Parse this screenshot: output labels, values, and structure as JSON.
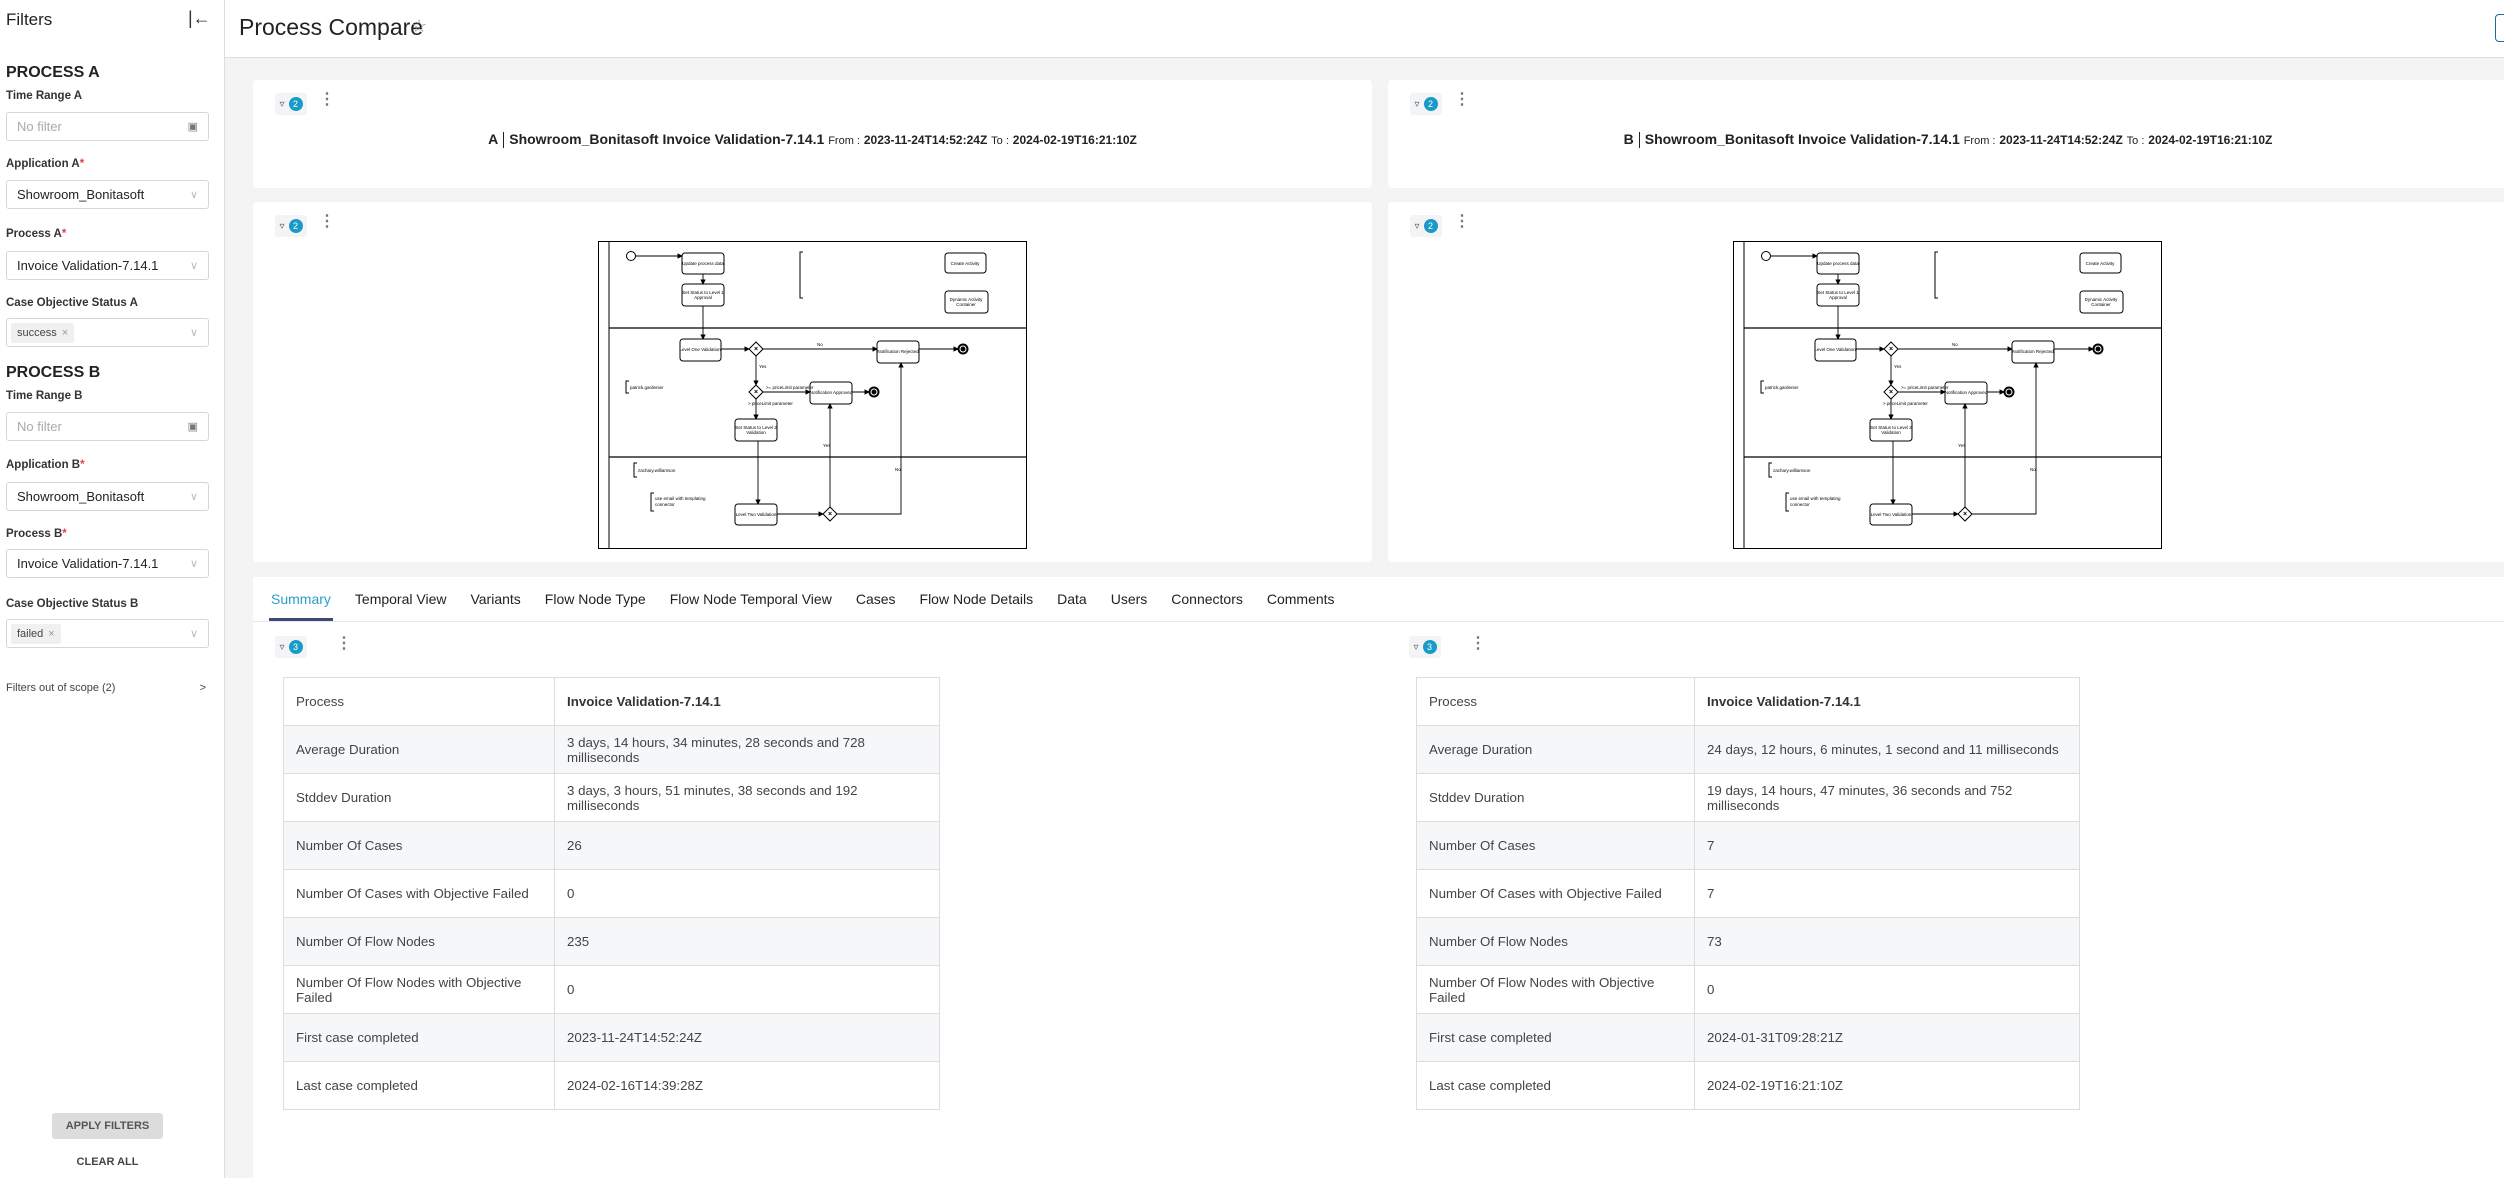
{
  "sidebar": {
    "title": "Filters",
    "collapse_icon": "collapse-left-icon",
    "process_a": {
      "heading": "PROCESS A",
      "time_range_label": "Time Range A",
      "time_range_placeholder": "No filter",
      "application_label": "Application A",
      "application_value": "Showroom_Bonitasoft",
      "process_label": "Process A",
      "process_value": "Invoice Validation-7.14.1",
      "status_label": "Case Objective Status A",
      "status_tag": "success"
    },
    "process_b": {
      "heading": "PROCESS B",
      "time_range_label": "Time Range B",
      "time_range_placeholder": "No filter",
      "application_label": "Application B",
      "application_value": "Showroom_Bonitasoft",
      "process_label": "Process B",
      "process_value": "Invoice Validation-7.14.1",
      "status_label": "Case Objective Status B",
      "status_tag": "failed"
    },
    "required_mark": "*",
    "out_of_scope": "Filters out of scope (2)",
    "apply": "APPLY FILTERS",
    "clear": "CLEAR ALL"
  },
  "header": {
    "title": "Process Compare"
  },
  "colors": {
    "accent": "#1a9bc7",
    "tab_underline": "#3c4a7a"
  },
  "cards": {
    "a": {
      "filter_count": "2",
      "letter": "A",
      "name": "Showroom_Bonitasoft Invoice Validation-7.14.1",
      "from_label": "From :",
      "from": "2023-11-24T14:52:24Z",
      "to_label": "To :",
      "to": "2024-02-19T16:21:10Z",
      "diagram_filter_count": "2"
    },
    "b": {
      "filter_count": "2",
      "letter": "B",
      "name": "Showroom_Bonitasoft Invoice Validation-7.14.1",
      "from_label": "From :",
      "from": "2023-11-24T14:52:24Z",
      "to_label": "To :",
      "to": "2024-02-19T16:21:10Z",
      "diagram_filter_count": "2"
    }
  },
  "diagram": {
    "tasks": {
      "update": "Update process data",
      "status1": "Set Status to Level 1",
      "status1b": "Approval",
      "create": "Create Activity",
      "dynamic": "Dynamic Activity",
      "dynamicb": "Container",
      "lvl1": "Level One Validation",
      "rejected": "Notification Rejected",
      "approved": "Notification Approved",
      "status2": "Set Status to Level 2",
      "status2b": "Validation",
      "lvl2": "Level Two Validation"
    },
    "labels": {
      "no": "No",
      "yes": "Yes",
      "ge": ">= priceLimit parameter",
      "gt": "> priceLimit parameter",
      "patrick": "patrick.gardenier",
      "zachary": "zachary.williamson",
      "email": "use email with templating",
      "email2": "connector"
    }
  },
  "tabs": [
    "Summary",
    "Temporal View",
    "Variants",
    "Flow Node Type",
    "Flow Node Temporal View",
    "Cases",
    "Flow Node Details",
    "Data",
    "Users",
    "Connectors",
    "Comments"
  ],
  "summary": {
    "a": {
      "filter_count": "3",
      "rows": [
        [
          "Process",
          "Invoice Validation-7.14.1"
        ],
        [
          "Average Duration",
          "3 days, 14 hours, 34 minutes, 28 seconds and 728 milliseconds"
        ],
        [
          "Stddev Duration",
          "3 days, 3 hours, 51 minutes, 38 seconds and 192 milliseconds"
        ],
        [
          "Number Of Cases",
          "26"
        ],
        [
          "Number Of Cases with Objective Failed",
          "0"
        ],
        [
          "Number Of Flow Nodes",
          "235"
        ],
        [
          "Number Of Flow Nodes with Objective Failed",
          "0"
        ],
        [
          "First case completed",
          "2023-11-24T14:52:24Z"
        ],
        [
          "Last case completed",
          "2024-02-16T14:39:28Z"
        ]
      ]
    },
    "b": {
      "filter_count": "3",
      "rows": [
        [
          "Process",
          "Invoice Validation-7.14.1"
        ],
        [
          "Average Duration",
          "24 days, 12 hours, 6 minutes, 1 second and 11 milliseconds"
        ],
        [
          "Stddev Duration",
          "19 days, 14 hours, 47 minutes, 36 seconds and 752 milliseconds"
        ],
        [
          "Number Of Cases",
          "7"
        ],
        [
          "Number Of Cases with Objective Failed",
          "7"
        ],
        [
          "Number Of Flow Nodes",
          "73"
        ],
        [
          "Number Of Flow Nodes with Objective Failed",
          "0"
        ],
        [
          "First case completed",
          "2024-01-31T09:28:21Z"
        ],
        [
          "Last case completed",
          "2024-02-19T16:21:10Z"
        ]
      ]
    }
  }
}
